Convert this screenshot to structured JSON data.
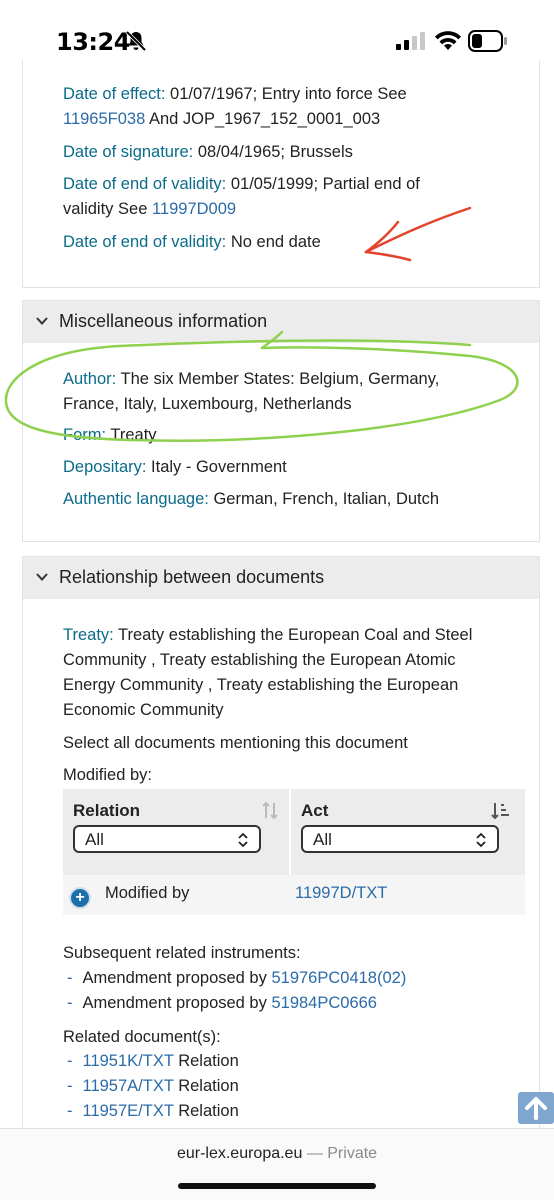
{
  "status": {
    "time": "13:24"
  },
  "dates": {
    "effect_label": "Date of effect:",
    "effect_text": "01/07/1967; Entry into force See",
    "effect_link": "11965F038",
    "effect_tail": "And JOP_1967_152_0001_003",
    "signature_label": "Date of signature:",
    "signature_text": "08/04/1965; Brussels",
    "end1_label": "Date of end of validity:",
    "end1_text": "01/05/1999; Partial end of",
    "end1_text2": "validity See",
    "end1_link": "11997D009",
    "end2_label": "Date of end of validity:",
    "end2_text": "No end date"
  },
  "misc": {
    "title": "Miscellaneous information",
    "author_label": "Author:",
    "author_text": "The six Member States: Belgium, Germany,",
    "author_text2": "France, Italy, Luxembourg, Netherlands",
    "form_label": "Form:",
    "form_text": "Treaty",
    "depositary_label": "Depositary:",
    "depositary_text": "Italy - Government",
    "language_label": "Authentic language:",
    "language_text": "German, French, Italian, Dutch"
  },
  "relationship": {
    "title": "Relationship between documents",
    "treaty_label": "Treaty:",
    "treaty_line1": "Treaty establishing the European Coal and Steel",
    "treaty_line2": "Community , Treaty establishing the European Atomic",
    "treaty_line3": "Energy Community , Treaty establishing the European",
    "treaty_line4": "Economic Community",
    "select_all_link": "Select all documents mentioning this document",
    "modified_by_label": "Modified by:",
    "table": {
      "col_relation": "Relation",
      "col_act": "Act",
      "relation_filter": "All",
      "act_filter": "All",
      "row_relation": "Modified by",
      "row_act": "11997D/TXT"
    },
    "subsequent_label": "Subsequent related instruments:",
    "subsequent": [
      {
        "text": "Amendment proposed by",
        "link": "51976PC0418(02)"
      },
      {
        "text": "Amendment proposed by",
        "link": "51984PC0666"
      }
    ],
    "related_label": "Related document(s):",
    "related": [
      {
        "link": "11951K/TXT",
        "text": "Relation"
      },
      {
        "link": "11957A/TXT",
        "text": "Relation"
      },
      {
        "link": "11957E/TXT",
        "text": "Relation"
      }
    ]
  },
  "browser": {
    "domain": "eur-lex.europa.eu",
    "mode": "— Private"
  }
}
